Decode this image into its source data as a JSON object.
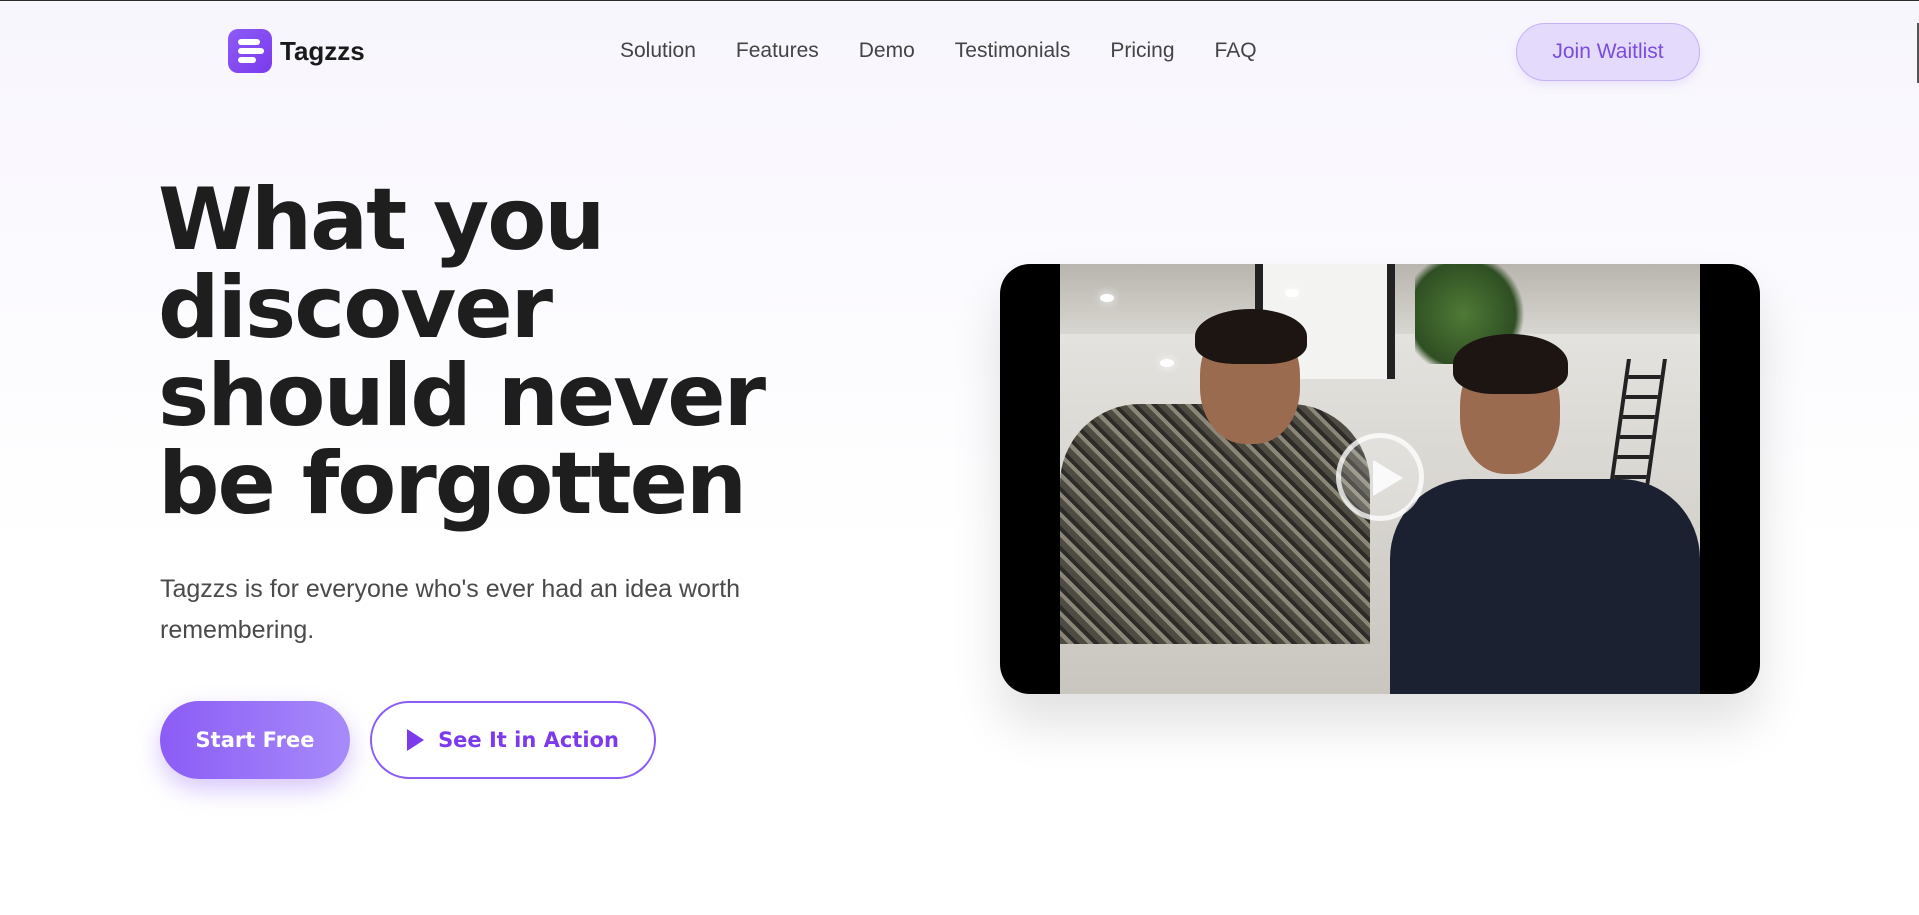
{
  "brand": {
    "name": "Tagzzs",
    "logo_icon": "tagzzs-logo-icon",
    "accent": "#8b5cf6"
  },
  "nav": {
    "links": [
      "Solution",
      "Features",
      "Demo",
      "Testimonials",
      "Pricing",
      "FAQ"
    ],
    "cta": "Join Waitlist"
  },
  "hero": {
    "headline_lines": [
      "What you",
      "discover",
      "should never",
      "be forgotten"
    ],
    "subtext": "Tagzzs is for everyone who's ever had an idea worth remembering.",
    "primary_cta": "Start Free",
    "secondary_cta": "See It in Action",
    "secondary_icon": "play-icon"
  },
  "video": {
    "overlay_icon": "play-circle-icon"
  }
}
